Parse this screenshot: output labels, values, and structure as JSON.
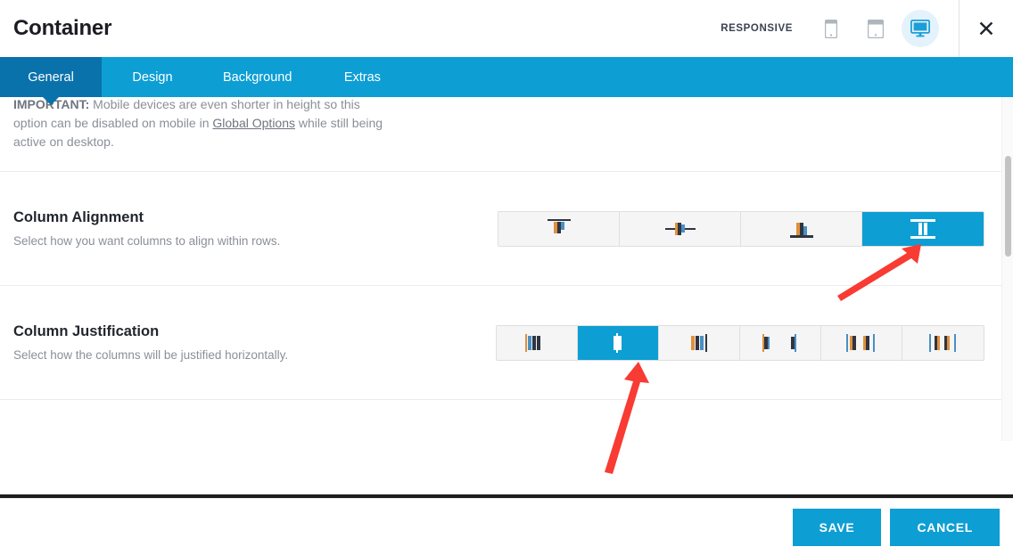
{
  "header": {
    "title": "Container",
    "responsive_label": "RESPONSIVE",
    "devices": [
      {
        "name": "mobile-icon",
        "label": "Mobile",
        "active": false
      },
      {
        "name": "tablet-icon",
        "label": "Tablet",
        "active": false
      },
      {
        "name": "desktop-icon",
        "label": "Desktop",
        "active": true
      }
    ],
    "close_label": "✕"
  },
  "tabs": [
    {
      "label": "General",
      "active": true
    },
    {
      "label": "Design",
      "active": false
    },
    {
      "label": "Background",
      "active": false
    },
    {
      "label": "Extras",
      "active": false
    }
  ],
  "notice": {
    "strong": "IMPORTANT:",
    "text_before": " Mobile devices are even shorter in height so this option can be disabled on mobile in ",
    "link": "Global Options",
    "text_after": " while still being active on desktop."
  },
  "settings": [
    {
      "title": "Column Alignment",
      "description": "Select how you want columns to align within rows.",
      "selected_index": 3,
      "options": [
        {
          "name": "align-top-icon",
          "value": "flex-start"
        },
        {
          "name": "align-middle-icon",
          "value": "center"
        },
        {
          "name": "align-bottom-icon",
          "value": "flex-end"
        },
        {
          "name": "align-stretch-icon",
          "value": "stretch"
        }
      ]
    },
    {
      "title": "Column Justification",
      "description": "Select how the columns will be justified horizontally.",
      "selected_index": 1,
      "options": [
        {
          "name": "justify-start-icon",
          "value": "flex-start"
        },
        {
          "name": "justify-center-icon",
          "value": "center"
        },
        {
          "name": "justify-end-icon",
          "value": "flex-end"
        },
        {
          "name": "justify-space-between-icon",
          "value": "space-between"
        },
        {
          "name": "justify-space-around-icon",
          "value": "space-around"
        },
        {
          "name": "justify-space-evenly-icon",
          "value": "space-evenly"
        }
      ]
    }
  ],
  "footer": {
    "save_label": "SAVE",
    "cancel_label": "CANCEL"
  },
  "colors": {
    "accent": "#0d9ed4",
    "accent_dark": "#0a72ab",
    "annotation": "#f83b33"
  }
}
